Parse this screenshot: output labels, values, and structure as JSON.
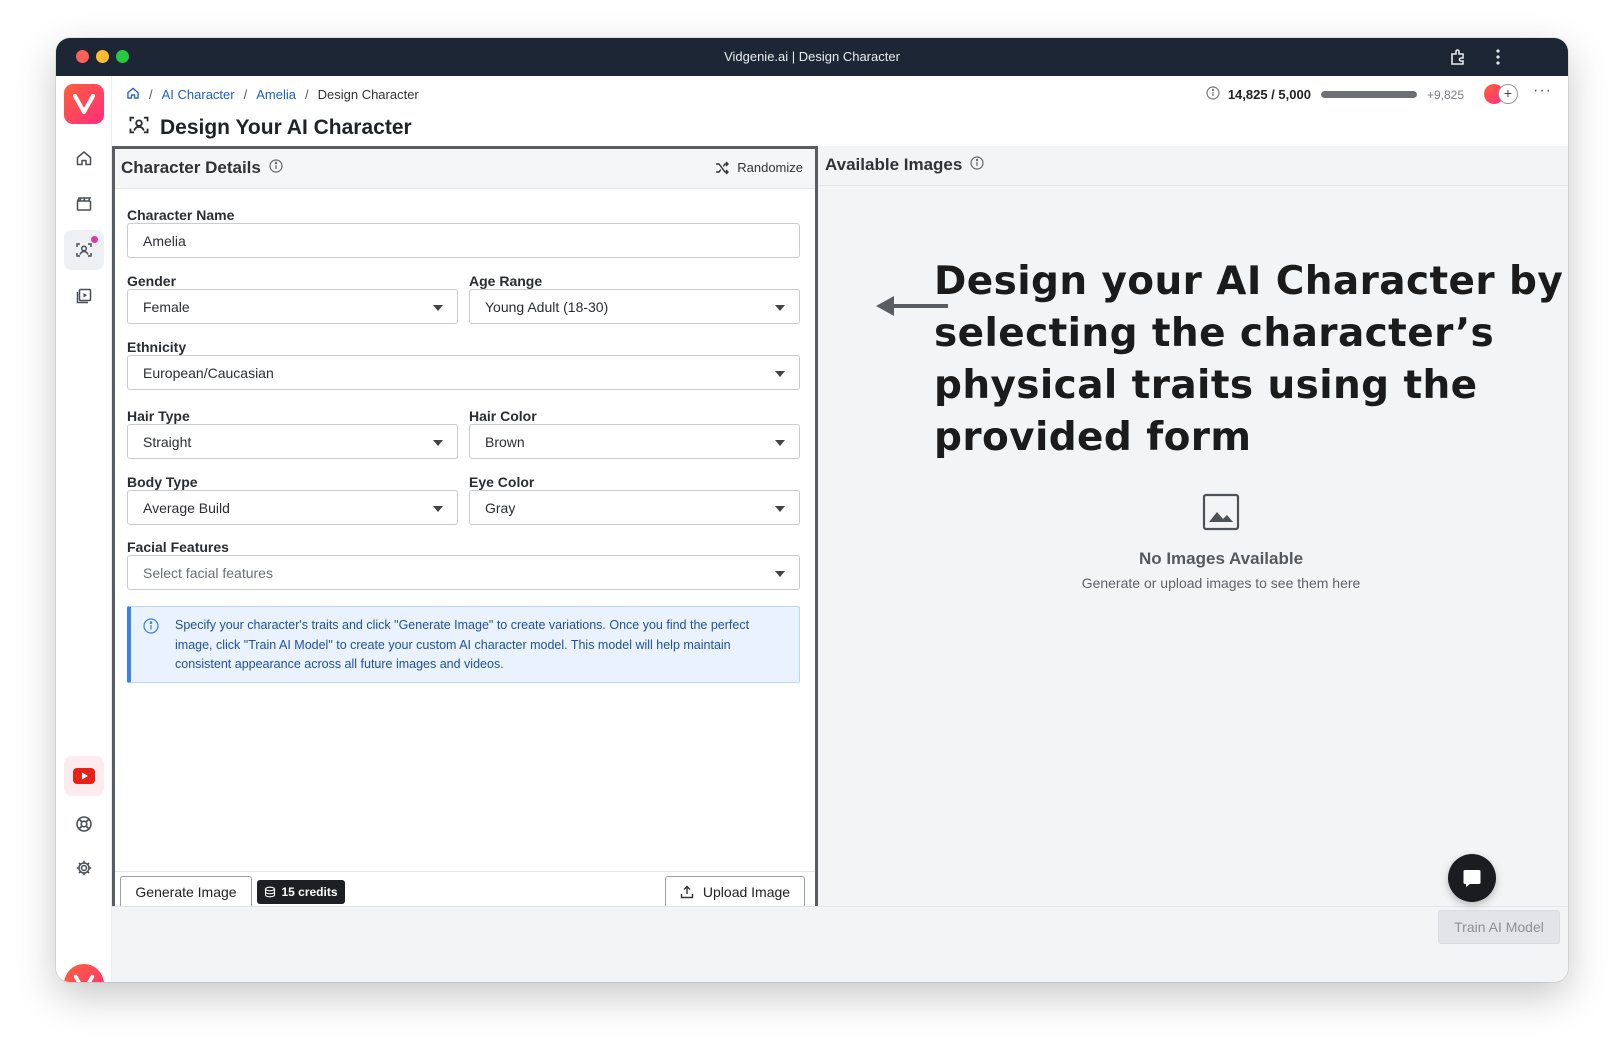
{
  "window": {
    "title": "Vidgenie.ai | Design Character"
  },
  "breadcrumb": {
    "items": [
      "AI Character",
      "Amelia"
    ],
    "current": "Design Character"
  },
  "usage": {
    "text": "14,825 / 5,000",
    "extra": "+9,825",
    "fill_percent": 100
  },
  "page": {
    "title": "Design Your AI Character"
  },
  "details": {
    "title": "Character Details",
    "randomize_label": "Randomize",
    "fields": {
      "name": {
        "label": "Character Name",
        "value": "Amelia"
      },
      "gender": {
        "label": "Gender",
        "value": "Female"
      },
      "age": {
        "label": "Age Range",
        "value": "Young Adult (18-30)"
      },
      "ethnicity": {
        "label": "Ethnicity",
        "value": "European/Caucasian"
      },
      "hair_type": {
        "label": "Hair Type",
        "value": "Straight"
      },
      "hair_color": {
        "label": "Hair Color",
        "value": "Brown"
      },
      "body_type": {
        "label": "Body Type",
        "value": "Average Build"
      },
      "eye_color": {
        "label": "Eye Color",
        "value": "Gray"
      },
      "facial": {
        "label": "Facial Features",
        "placeholder": "Select facial features"
      }
    },
    "info_text": "Specify your character's traits and click \"Generate Image\" to create variations. Once you find the perfect image, click \"Train AI Model\" to create your custom AI character model. This model will help maintain consistent appearance across all future images and videos.",
    "generate_label": "Generate Image",
    "credits_label": "15 credits",
    "upload_label": "Upload Image"
  },
  "images": {
    "title": "Available Images",
    "empty_title": "No Images Available",
    "empty_sub": "Generate or upload images to see them here"
  },
  "annotation": {
    "text": "Design your AI Character by selecting the character’s physical traits using the provided form"
  },
  "train_label": "Train AI Model",
  "colors": {
    "brand": "#ff3d6b",
    "link": "#1e5fc8",
    "info_bg": "#eaf3fd",
    "info_text": "#1f4f9e",
    "youtube": "#e62117"
  }
}
